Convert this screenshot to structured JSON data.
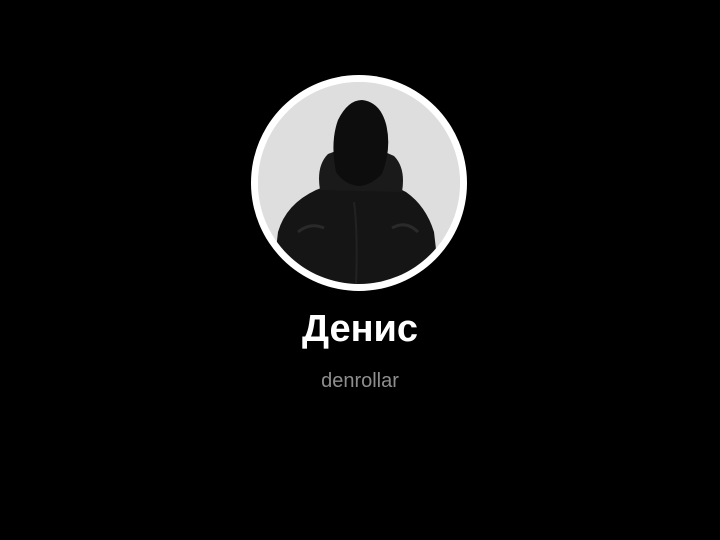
{
  "profile": {
    "display_name": "Денис",
    "username": "denrollar",
    "avatar_icon": "hooded-person-silhouette"
  },
  "colors": {
    "background": "#000000",
    "avatar_ring": "#ffffff",
    "name_text": "#ffffff",
    "username_text": "#8e8e8e"
  }
}
